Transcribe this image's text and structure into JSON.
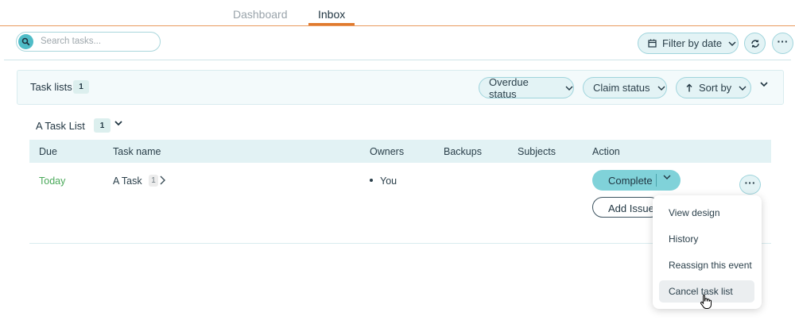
{
  "tabs": [
    {
      "label": "Dashboard"
    },
    {
      "label": "Inbox",
      "active": true
    }
  ],
  "toolbar": {
    "search_placeholder": "Search tasks...",
    "filter_label": "Filter by date"
  },
  "task_lists_bar": {
    "title": "Task lists",
    "count": "1",
    "overdue_label": "Overdue status",
    "claim_label": "Claim status",
    "sort_label": "Sort by"
  },
  "task_list": {
    "name": "A Task List",
    "count": "1",
    "columns": [
      "Due",
      "Task name",
      "Owners",
      "Backups",
      "Subjects",
      "Action"
    ],
    "row": {
      "due": "Today",
      "task_name": "A Task",
      "task_count": "1",
      "owner": "You",
      "complete_label": "Complete",
      "issue_label": "Add Issue"
    }
  },
  "menu": {
    "items": [
      "View design",
      "History",
      "Reassign this event",
      "Cancel task list"
    ]
  },
  "colors": {
    "accent": "#e07a2e",
    "teal": "#80d2d9",
    "due_green": "#4aa95a"
  }
}
